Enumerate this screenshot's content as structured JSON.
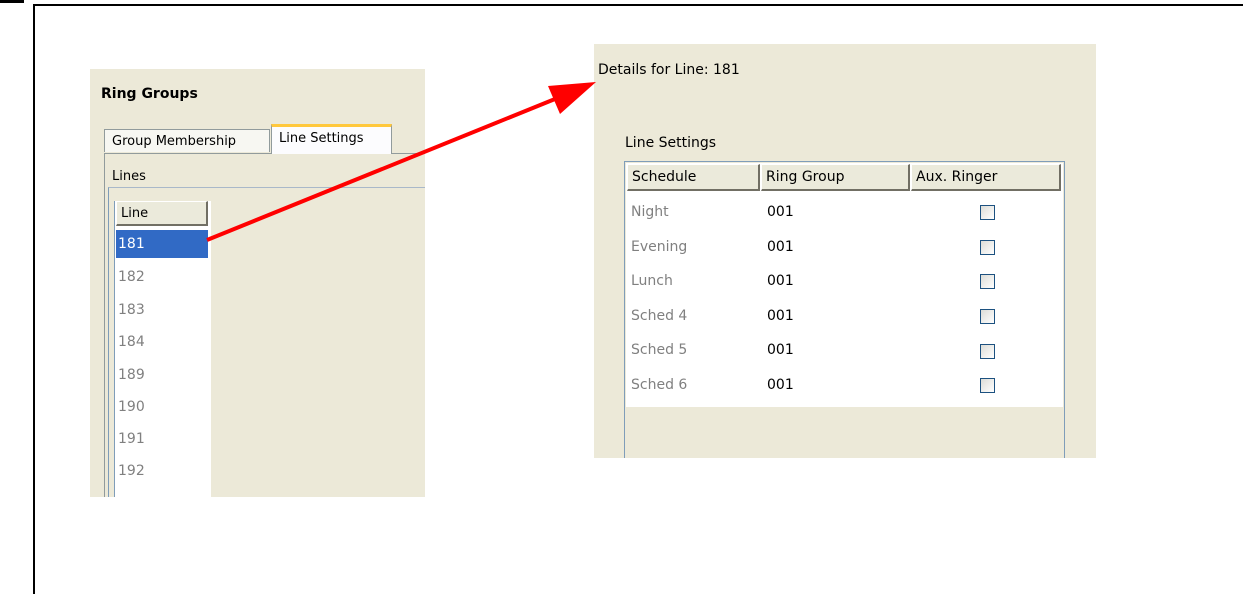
{
  "ring_groups_panel": {
    "title": "Ring Groups",
    "tabs": [
      {
        "label": "Group Membership",
        "active": false
      },
      {
        "label": "Line Settings",
        "active": true
      }
    ],
    "lines_group_label": "Lines",
    "list_header": "Line",
    "lines": [
      "181",
      "182",
      "183",
      "184",
      "189",
      "190",
      "191",
      "192"
    ],
    "selected_line": "181"
  },
  "details_panel": {
    "title": "Details for Line: 181",
    "section_label": "Line Settings",
    "columns": [
      "Schedule",
      "Ring Group",
      "Aux. Ringer"
    ],
    "rows": [
      {
        "schedule": "Night",
        "ring_group": "001",
        "aux_ringer": false
      },
      {
        "schedule": "Evening",
        "ring_group": "001",
        "aux_ringer": false
      },
      {
        "schedule": "Lunch",
        "ring_group": "001",
        "aux_ringer": false
      },
      {
        "schedule": "Sched 4",
        "ring_group": "001",
        "aux_ringer": false
      },
      {
        "schedule": "Sched 5",
        "ring_group": "001",
        "aux_ringer": false
      },
      {
        "schedule": "Sched 6",
        "ring_group": "001",
        "aux_ringer": false
      }
    ]
  },
  "colors": {
    "arrow": "#ff0000",
    "selection": "#316ac5",
    "panel_bg": "#ece9d8"
  }
}
